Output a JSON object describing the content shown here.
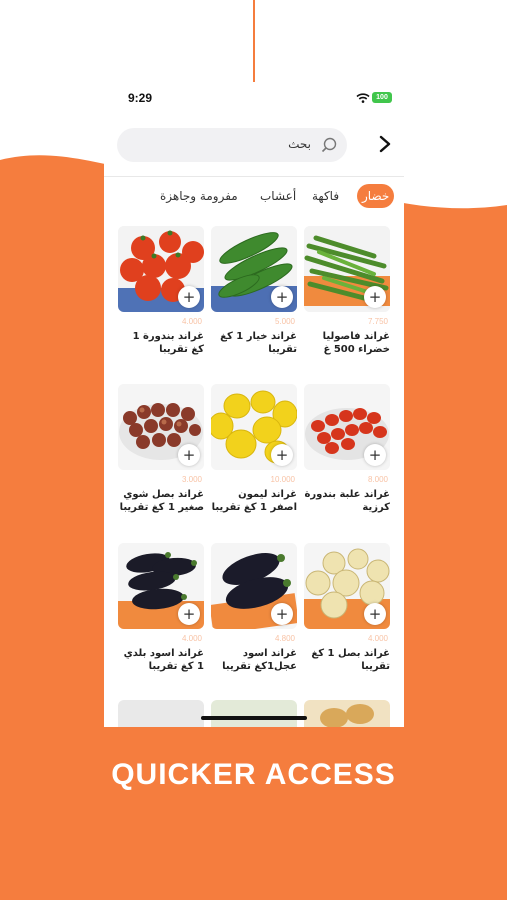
{
  "status_bar": {
    "time": "9:29",
    "battery": "100"
  },
  "search": {
    "placeholder": "بحث"
  },
  "tabs": [
    {
      "label": "خضار",
      "active": true
    },
    {
      "label": "فاكهة",
      "active": false
    },
    {
      "label": "أعشاب",
      "active": false
    },
    {
      "label": "مفرومة وجاهزة",
      "active": false
    }
  ],
  "products": [
    {
      "name": "غراند فاصوليا خضراء 500 غ",
      "price": "7.750",
      "image": "green-beans"
    },
    {
      "name": "غراند خيار 1 كغ تقريبا",
      "price": "5.000",
      "image": "cucumbers"
    },
    {
      "name": "غراند بندورة 1 كغ تقريبا",
      "price": "4.000",
      "image": "tomatoes"
    },
    {
      "name": "غراند علبة بندورة كرزية",
      "price": "8.000",
      "image": "cherry-tomatoes"
    },
    {
      "name": "غراند ليمون اصفر 1 كغ تقريبا",
      "price": "10.000",
      "image": "lemons"
    },
    {
      "name": "غراند بصل شوي صغير 1 كغ تقريبا",
      "price": "3.000",
      "image": "small-onions"
    },
    {
      "name": "غراند بصل 1 كغ تقريبا",
      "price": "4.000",
      "image": "onions"
    },
    {
      "name": "غراند اسود عجل1كغ تقريبا",
      "price": "4.800",
      "image": "eggplant-large"
    },
    {
      "name": "غراند اسود بلدي 1 كغ تقريبا",
      "price": "4.000",
      "image": "eggplant-small"
    }
  ],
  "headline": "QUICKER ACCESS",
  "colors": {
    "accent": "#f57d3e",
    "background": "#ffffff",
    "price": "#f8c3a6"
  }
}
